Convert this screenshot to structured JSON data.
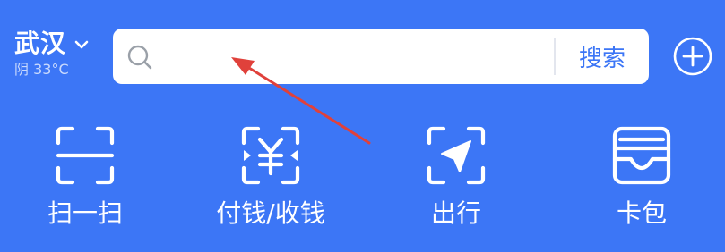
{
  "location": {
    "city": "武汉",
    "weather": "阴 33°C"
  },
  "search": {
    "placeholder": "",
    "button_label": "搜索"
  },
  "actions": [
    {
      "label": "扫一扫",
      "icon": "scan-icon"
    },
    {
      "label": "付钱/收钱",
      "icon": "pay-receive-icon"
    },
    {
      "label": "出行",
      "icon": "travel-icon"
    },
    {
      "label": "卡包",
      "icon": "card-wallet-icon"
    }
  ],
  "colors": {
    "background": "#3c76f6",
    "accent": "#3c76f6",
    "annotation_arrow": "#e0413b"
  }
}
